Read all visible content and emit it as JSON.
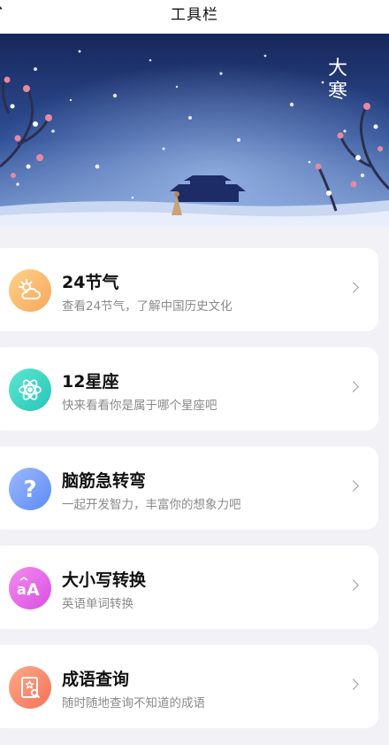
{
  "topbar": {
    "title": "工具栏"
  },
  "banner": {
    "text": "大寒"
  },
  "items": [
    {
      "name": "24节气",
      "desc": "查看24节气，了解中国历史文化",
      "icon": "cloud-sun-icon",
      "color_from": "#fdd18a",
      "color_to": "#f9a85a"
    },
    {
      "name": "12星座",
      "desc": "快来看看你是属于哪个星座吧",
      "icon": "atom-icon",
      "color_from": "#5de6d0",
      "color_to": "#25c7b8"
    },
    {
      "name": "脑筋急转弯",
      "desc": "一起开发智力，丰富你的想象力吧",
      "icon": "question-icon",
      "color_from": "#9ab8ff",
      "color_to": "#5d8cf5"
    },
    {
      "name": "大小写转换",
      "desc": "英语单词转换",
      "icon": "text-case-icon",
      "color_from": "#f48cf0",
      "color_to": "#d94fe0"
    },
    {
      "name": "成语查询",
      "desc": "随时随地查询不知道的成语",
      "icon": "book-search-icon",
      "color_from": "#ffa98a",
      "color_to": "#f47256"
    }
  ]
}
